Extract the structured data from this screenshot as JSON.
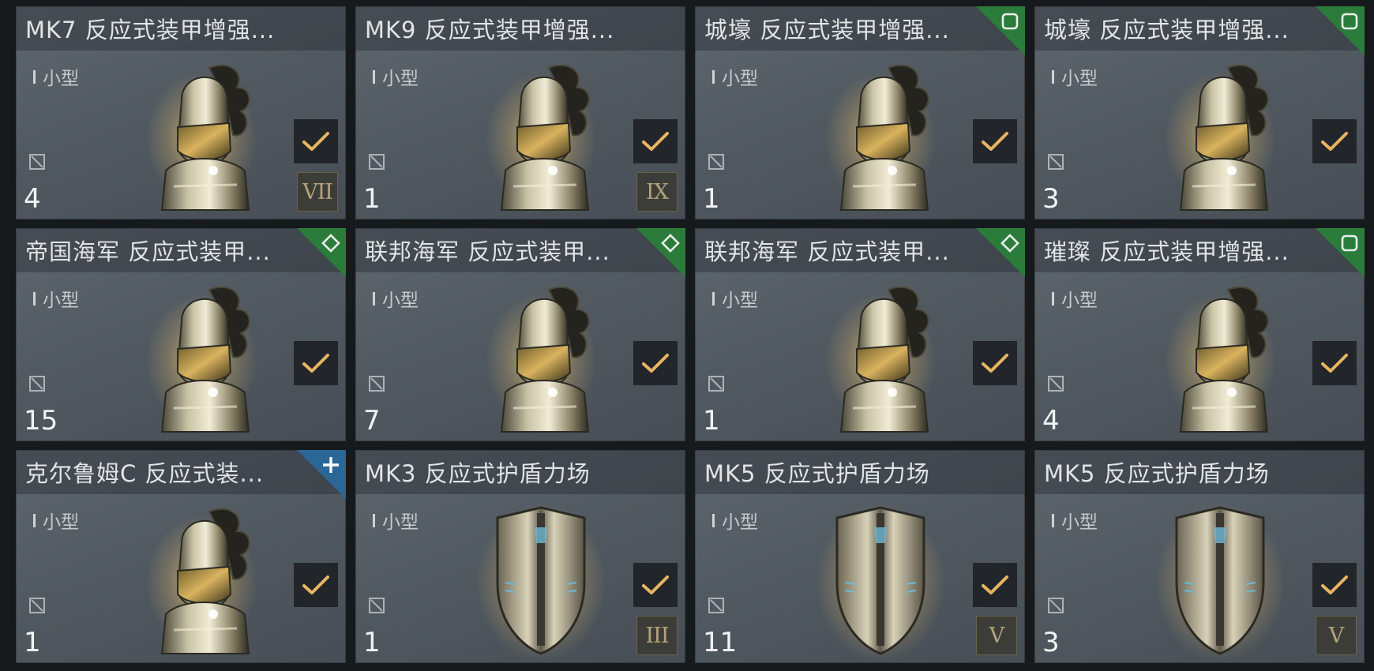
{
  "cards": [
    {
      "title": "MK7 反应式装甲增强...",
      "size": "小型",
      "qty": "4",
      "tier": "VII",
      "meta": "",
      "art": "helmet-icon"
    },
    {
      "title": "MK9 反应式装甲增强...",
      "size": "小型",
      "qty": "1",
      "tier": "IX",
      "meta": "",
      "art": "helmet-icon"
    },
    {
      "title": "城壕 反应式装甲增强...",
      "size": "小型",
      "qty": "1",
      "tier": "",
      "meta": "storyline",
      "art": "helmet-icon"
    },
    {
      "title": "城壕 反应式装甲增强...",
      "size": "小型",
      "qty": "3",
      "tier": "",
      "meta": "storyline",
      "art": "helmet-icon"
    },
    {
      "title": "帝国海军 反应式装甲...",
      "size": "小型",
      "qty": "15",
      "tier": "",
      "meta": "faction",
      "art": "helmet-icon"
    },
    {
      "title": "联邦海军 反应式装甲...",
      "size": "小型",
      "qty": "7",
      "tier": "",
      "meta": "faction",
      "art": "helmet-icon"
    },
    {
      "title": "联邦海军 反应式装甲...",
      "size": "小型",
      "qty": "1",
      "tier": "",
      "meta": "faction",
      "art": "helmet-icon"
    },
    {
      "title": "璀璨 反应式装甲增强...",
      "size": "小型",
      "qty": "4",
      "tier": "",
      "meta": "storyline",
      "art": "helmet-icon"
    },
    {
      "title": "克尔鲁姆C 反应式装...",
      "size": "小型",
      "qty": "1",
      "tier": "",
      "meta": "tech2",
      "art": "helmet-icon"
    },
    {
      "title": "MK3 反应式护盾力场",
      "size": "小型",
      "qty": "1",
      "tier": "III",
      "meta": "",
      "art": "shield-icon"
    },
    {
      "title": "MK5 反应式护盾力场",
      "size": "小型",
      "qty": "11",
      "tier": "V",
      "meta": "",
      "art": "shield-icon"
    },
    {
      "title": "MK5 反应式护盾力场",
      "size": "小型",
      "qty": "3",
      "tier": "V",
      "meta": "",
      "art": "shield-icon"
    }
  ],
  "colors": {
    "card_bg": "#555d64",
    "checkmark": "#e8b562",
    "tier_text": "#b3a27c",
    "corner_green": "#2b7c3b",
    "corner_blue": "#2a6796"
  },
  "icons": {
    "unfit": "unfit-icon",
    "check": "check-icon",
    "faction": "diamond-icon",
    "storyline": "rounded-square-icon",
    "tech2": "plus-icon"
  }
}
